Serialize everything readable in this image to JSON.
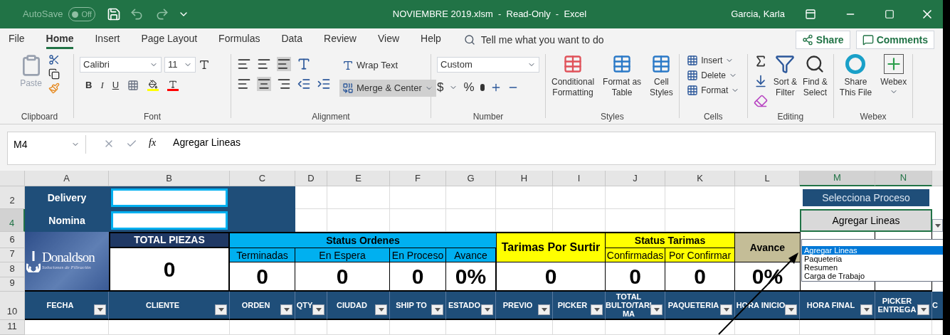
{
  "title_bar": {
    "autosave": "AutoSave",
    "autosave_toggle": {
      "label": "Off",
      "on": false
    },
    "title": "NOVIEMBRE 2019.xlsm  -  Read-Only  -  Excel",
    "user": "Garcia, Karla"
  },
  "menu_tabs": [
    {
      "label": "File",
      "selected": false
    },
    {
      "label": "Home",
      "selected": true
    },
    {
      "label": "Insert",
      "selected": false
    },
    {
      "label": "Page Layout",
      "selected": false
    },
    {
      "label": "Formulas",
      "selected": false
    },
    {
      "label": "Data",
      "selected": false
    },
    {
      "label": "Review",
      "selected": false
    },
    {
      "label": "View",
      "selected": false
    },
    {
      "label": "Help",
      "selected": false
    }
  ],
  "tell_me": "Tell me what you want to do",
  "share": "Share",
  "comments": "Comments",
  "ribbon": {
    "clipboard": {
      "paste": "Paste",
      "label": "Clipboard"
    },
    "font": {
      "name": "Calibri",
      "size": "11",
      "bold": "B",
      "italic": "I",
      "underline": "U",
      "label": "Font"
    },
    "alignment": {
      "wrap_text": "Wrap Text",
      "merge_center": "Merge & Center",
      "label": "Alignment"
    },
    "number": {
      "format": "Custom",
      "currency": "$",
      "percent": "%",
      "label": "Number"
    },
    "styles": {
      "buttons": [
        {
          "line1": "Conditional",
          "line2": "Formatting"
        },
        {
          "line1": "Format as",
          "line2": "Table"
        },
        {
          "line1": "Cell",
          "line2": "Styles"
        }
      ],
      "label": "Styles"
    },
    "cells": {
      "buttons": [
        "Insert",
        "Delete",
        "Format"
      ],
      "label": "Cells"
    },
    "editing": {
      "buttons": [
        {
          "line1": "Sort &",
          "line2": "Filter"
        },
        {
          "line1": "Find &",
          "line2": "Select"
        }
      ],
      "label": "Editing"
    },
    "webex": {
      "buttons": [
        {
          "line1": "Share",
          "line2": "This File"
        },
        {
          "line1": "Webex"
        }
      ],
      "label": "Webex"
    }
  },
  "formula_bar": {
    "name_box": "M4",
    "fx": "fx",
    "formula": "Agregar Lineas"
  },
  "sheet": {
    "columns": [
      {
        "label": "A",
        "selected": false
      },
      {
        "label": "B",
        "selected": false
      },
      {
        "label": "C",
        "selected": false
      },
      {
        "label": "D",
        "selected": false
      },
      {
        "label": "E",
        "selected": false
      },
      {
        "label": "F",
        "selected": false
      },
      {
        "label": "G",
        "selected": false
      },
      {
        "label": "H",
        "selected": false
      },
      {
        "label": "I",
        "selected": false
      },
      {
        "label": "J",
        "selected": false
      },
      {
        "label": "K",
        "selected": false
      },
      {
        "label": "L",
        "selected": false
      },
      {
        "label": "M",
        "selected": true
      },
      {
        "label": "N",
        "selected": true
      }
    ],
    "rows": [
      {
        "label": "2",
        "selected": false
      },
      {
        "label": "4",
        "selected": true
      },
      {
        "label": "6",
        "selected": false
      },
      {
        "label": "7",
        "selected": false
      },
      {
        "label": "8",
        "selected": false
      },
      {
        "label": "9",
        "selected": false
      },
      {
        "label": "10",
        "selected": false
      },
      {
        "label": "11",
        "selected": false
      }
    ],
    "delivery_label": "Delivery",
    "nomina_label": "Nomina",
    "logo": {
      "name": "Donaldson",
      "tagline": "Soluciones de Filtración"
    },
    "total_piezas": {
      "title": "TOTAL PIEZAS",
      "value": "0"
    },
    "status_ordenes": {
      "title": "Status Ordenes",
      "items": [
        {
          "label": "Terminadas",
          "value": "0"
        },
        {
          "label": "En Espera",
          "value": "0"
        },
        {
          "label": "En Proceso",
          "value": "0"
        },
        {
          "label": "Avance",
          "value": "0%"
        }
      ]
    },
    "tarimas_por_surtir": {
      "title": "Tarimas Por Surtir",
      "value": "0"
    },
    "status_tarimas": {
      "title": "Status Tarimas",
      "items": [
        {
          "label": "Confirmadas",
          "value": "0"
        },
        {
          "label": "Por Confirmar",
          "value": "0"
        }
      ]
    },
    "avance": {
      "title": "Avance",
      "value": "0%"
    },
    "selecciona_proceso": "Selecciona Proceso",
    "proceso_value": "Agregar Lineas",
    "proceso_options": [
      {
        "label": "Agregar Lineas",
        "selected": true
      },
      {
        "label": "Paqueteria",
        "selected": false
      },
      {
        "label": "Resumen",
        "selected": false
      },
      {
        "label": "Carga de Trabajo",
        "selected": false
      }
    ],
    "table_headers": [
      "FECHA",
      "CLIENTE",
      "ORDEN",
      "QTY",
      "CIUDAD",
      "SHIP TO",
      "ESTADO",
      "PREVIO",
      "PICKER",
      "TOTAL BULTO/TARIMA",
      "PAQUETERIA",
      "HORA INICIO",
      "HORA FINAL",
      "PICKER ENTREGA",
      "C"
    ]
  }
}
